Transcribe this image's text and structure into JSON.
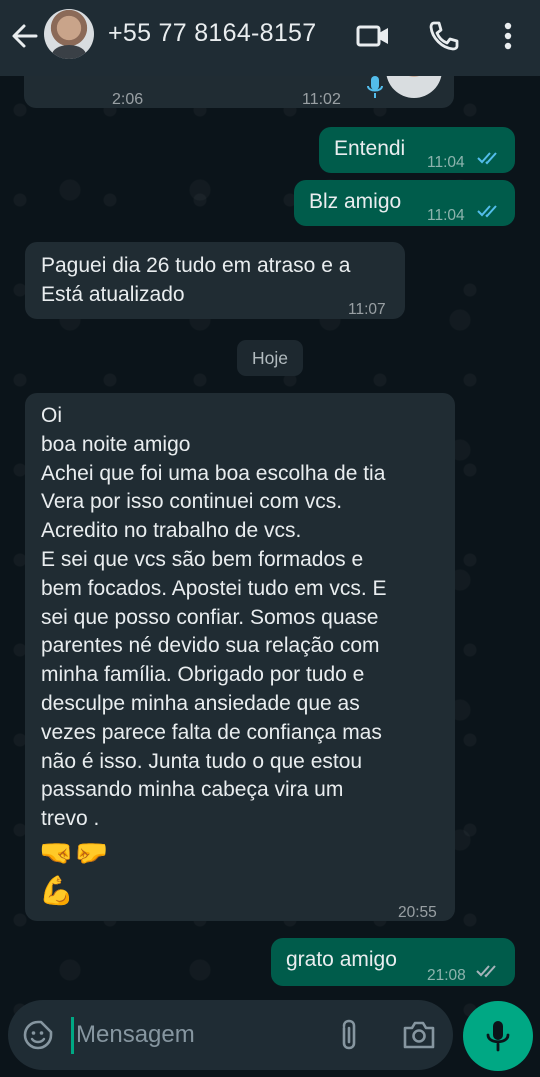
{
  "header": {
    "contact": "+55 77 8164-8157",
    "icons": [
      "back-arrow-icon",
      "video-call-icon",
      "phone-icon",
      "more-vert-icon"
    ]
  },
  "prev_audio": {
    "duration": "2:06",
    "time": "11:02"
  },
  "messages": [
    {
      "dir": "out",
      "text": "Entendi",
      "time": "11:04",
      "status": "read"
    },
    {
      "dir": "out",
      "text": "Blz amigo",
      "time": "11:04",
      "status": "read"
    },
    {
      "dir": "in",
      "text": "Paguei dia 26 tudo em atraso e a\nEstá atualizado",
      "time": "11:07"
    },
    {
      "dir": "in",
      "text": "Oi\nboa noite amigo\nAchei que foi uma boa escolha de tia\nVera por isso continuei com vcs.\nAcredito no trabalho de vcs.\nE sei que vcs são bem formados e\nbem focados. Apostei tudo em vcs. E\nsei que posso confiar. Somos quase\nparentes né devido sua relação com\nminha família. Obrigado por tudo e\ndesculpe minha ansiedade que as\nvezes parece falta de confiança mas\nnão é isso. Junta tudo o que estou\npassando minha cabeça vira um\ntrevo .",
      "emoji_line1": "🤜🤛",
      "emoji_line2": "💪",
      "time": "20:55"
    },
    {
      "dir": "out",
      "text": "grato amigo",
      "time": "21:08",
      "status": "delivered"
    }
  ],
  "date_separator": "Hoje",
  "composer": {
    "placeholder": "Mensagem"
  },
  "colors": {
    "background": "#0b141a",
    "header": "#1f2c34",
    "incoming": "#202c33",
    "outgoing": "#005c4b",
    "accent": "#00a884",
    "read_ticks": "#53bdeb"
  }
}
